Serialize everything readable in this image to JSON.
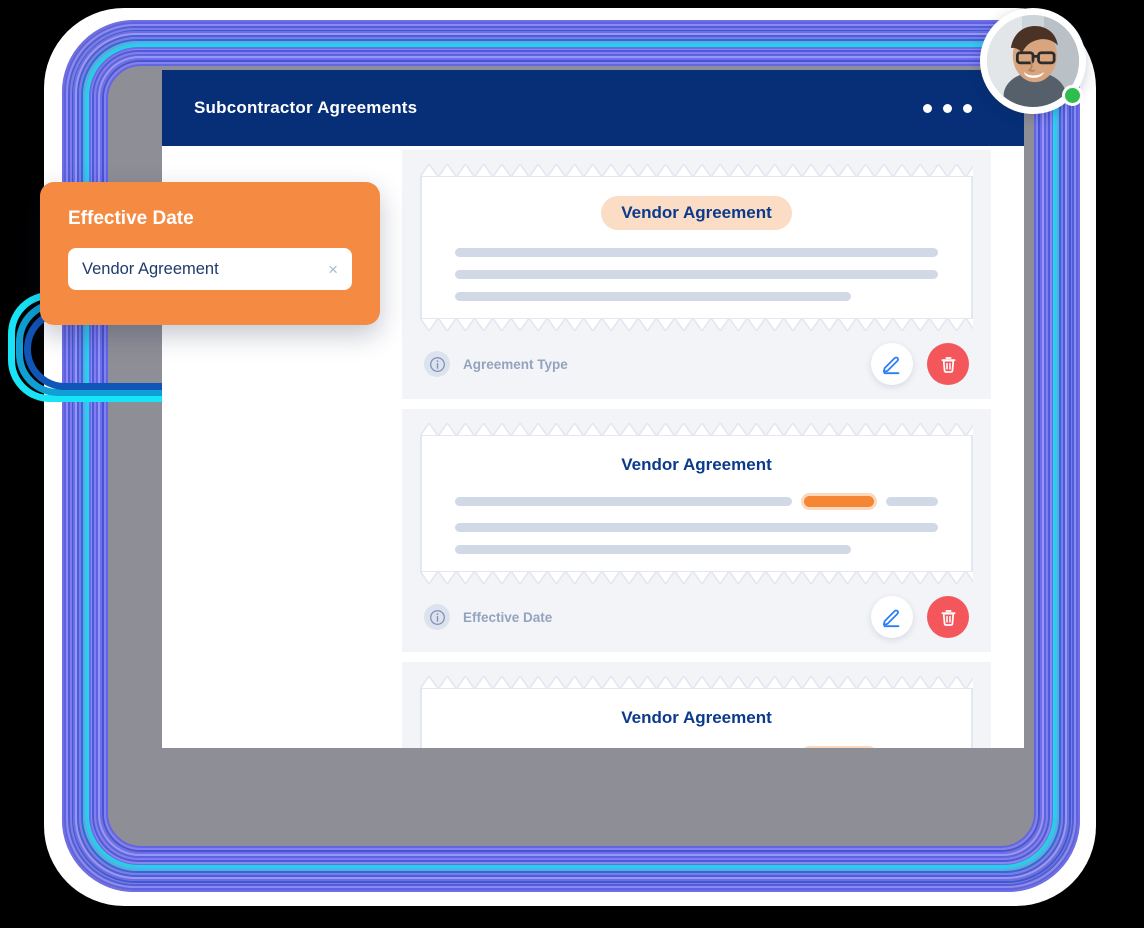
{
  "window": {
    "title": "Subcontractor Agreements",
    "menu_icon": "three-dots-icon",
    "header_color": "#062F77"
  },
  "user": {
    "avatar_alt": "user-avatar",
    "status": "online",
    "status_color": "#2DBE4E"
  },
  "filter_panel": {
    "label": "Effective Date",
    "input_value": "Vendor Agreement",
    "input_placeholder": "Vendor Agreement",
    "clear_icon": "×",
    "panel_color": "#F58B43"
  },
  "cards": [
    {
      "title": "Vendor Agreement",
      "title_style": "chip",
      "footer_label": "Agreement Type",
      "info_icon": "info-icon",
      "edit_icon": "pencil-icon",
      "delete_icon": "trash-icon",
      "highlight": "none"
    },
    {
      "title": "Vendor Agreement",
      "title_style": "plain",
      "footer_label": "Effective Date",
      "info_icon": "info-icon",
      "edit_icon": "pencil-icon",
      "delete_icon": "trash-icon",
      "highlight": "inline-pill"
    },
    {
      "title": "Vendor Agreement",
      "title_style": "plain",
      "footer_label": "",
      "info_icon": "info-icon",
      "edit_icon": "pencil-icon",
      "delete_icon": "trash-icon",
      "highlight": "inline-pill"
    }
  ],
  "colors": {
    "accent_orange": "#F58634",
    "chip_peach": "#FBDCC4",
    "navy": "#0B3A8C",
    "delete_red": "#F4575B",
    "skeleton": "#D2D9E6",
    "card_bg": "#F2F4F7"
  }
}
